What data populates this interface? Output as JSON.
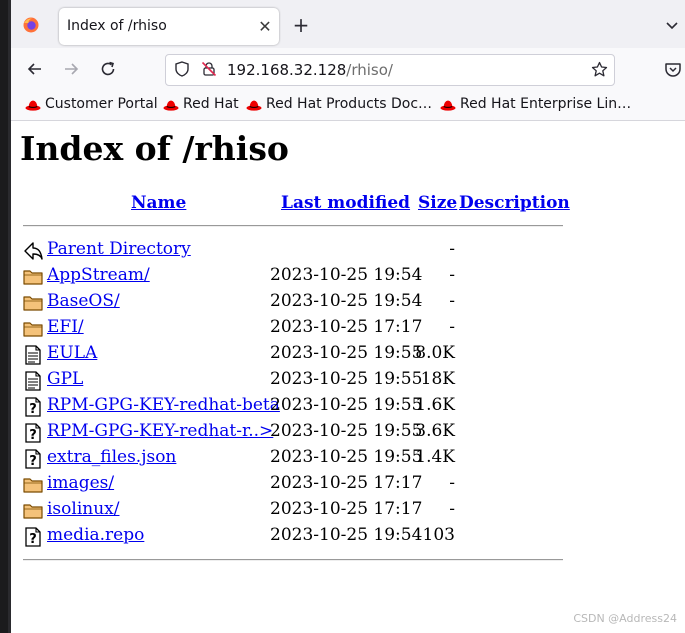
{
  "tab": {
    "title": "Index of /rhiso",
    "close_glyph": "✕"
  },
  "newtab_glyph": "+",
  "urlbar": {
    "host": "192.168.32.128",
    "path": "/rhiso/"
  },
  "bookmarks": [
    {
      "label": "Customer Portal"
    },
    {
      "label": "Red Hat"
    },
    {
      "label": "Red Hat Products Doc…"
    },
    {
      "label": "Red Hat Enterprise Lin…"
    }
  ],
  "page": {
    "heading": "Index of /rhiso",
    "columns": {
      "name": "Name",
      "modified": "Last modified",
      "size": "Size",
      "description": "Description"
    },
    "rows": [
      {
        "icon": "back-icon",
        "name": "Parent Directory",
        "modified": "",
        "size": "-"
      },
      {
        "icon": "folder-icon",
        "name": "AppStream/",
        "modified": "2023-10-25 19:54",
        "size": "-"
      },
      {
        "icon": "folder-icon",
        "name": "BaseOS/",
        "modified": "2023-10-25 19:54",
        "size": "-"
      },
      {
        "icon": "folder-icon",
        "name": "EFI/",
        "modified": "2023-10-25 17:17",
        "size": "-"
      },
      {
        "icon": "text-file-icon",
        "name": "EULA",
        "modified": "2023-10-25 19:55",
        "size": "8.0K"
      },
      {
        "icon": "text-file-icon",
        "name": "GPL",
        "modified": "2023-10-25 19:55",
        "size": "18K"
      },
      {
        "icon": "unknown-file-icon",
        "name": "RPM-GPG-KEY-redhat-beta",
        "modified": "2023-10-25 19:55",
        "size": "1.6K"
      },
      {
        "icon": "unknown-file-icon",
        "name": "RPM-GPG-KEY-redhat-r..>",
        "modified": "2023-10-25 19:55",
        "size": "3.6K"
      },
      {
        "icon": "unknown-file-icon",
        "name": "extra_files.json",
        "modified": "2023-10-25 19:55",
        "size": "1.4K"
      },
      {
        "icon": "folder-icon",
        "name": "images/",
        "modified": "2023-10-25 17:17",
        "size": "-"
      },
      {
        "icon": "folder-icon",
        "name": "isolinux/",
        "modified": "2023-10-25 17:17",
        "size": "-"
      },
      {
        "icon": "unknown-file-icon",
        "name": "media.repo",
        "modified": "2023-10-25 19:54",
        "size": "103"
      }
    ]
  },
  "watermark": "CSDN @Address24",
  "colors": {
    "link": "#0000ee",
    "redhat": "#ee0000",
    "folder": "#e8a33a"
  }
}
